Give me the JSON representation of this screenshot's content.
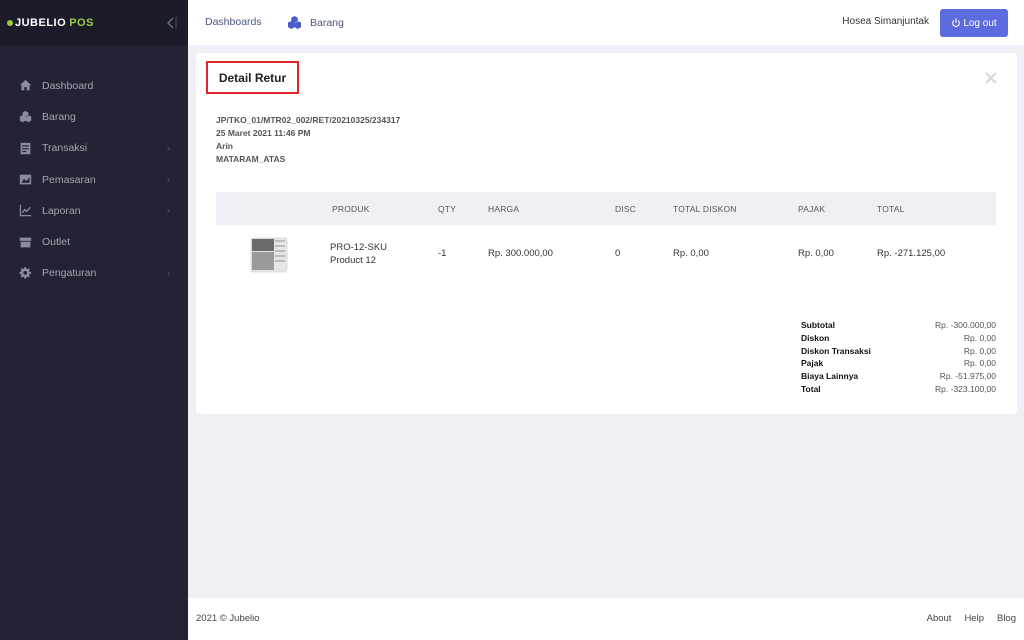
{
  "app": {
    "logo_main": "JUBELIO",
    "logo_sub": "POS",
    "accent": "#9ccd3c",
    "sidebar_bg": "#232333"
  },
  "sidebar": {
    "items": [
      {
        "label": "Dashboard",
        "icon": "home-icon",
        "has_children": false
      },
      {
        "label": "Barang",
        "icon": "cubes-icon",
        "has_children": false
      },
      {
        "label": "Transaksi",
        "icon": "receipt-icon",
        "has_children": true
      },
      {
        "label": "Pemasaran",
        "icon": "chart-area-icon",
        "has_children": true
      },
      {
        "label": "Laporan",
        "icon": "line-chart-icon",
        "has_children": true
      },
      {
        "label": "Outlet",
        "icon": "store-icon",
        "has_children": false
      },
      {
        "label": "Pengaturan",
        "icon": "gear-icon",
        "has_children": true
      }
    ]
  },
  "header": {
    "links": {
      "dashboards": "Dashboards",
      "barang": "Barang"
    },
    "user_name": "Hosea Simanjuntak",
    "logout_label": "Log out",
    "logout_color": "#5c6bde"
  },
  "detail": {
    "title": "Detail Retur",
    "ref_no": "JP/TKO_01/MTR02_002/RET/20210325/234317",
    "date": "25 Maret 2021 11:46 PM",
    "customer": "Arin",
    "location": "MATARAM_ATAS"
  },
  "table": {
    "headers": {
      "produk": "PRODUK",
      "qty": "QTY",
      "harga": "HARGA",
      "disc": "DISC",
      "total_diskon": "TOTAL DISKON",
      "pajak": "PAJAK",
      "total": "TOTAL"
    },
    "rows": [
      {
        "sku": "PRO-12-SKU",
        "name": "Product 12",
        "qty": "-1",
        "harga": "Rp. 300.000,00",
        "disc": "0",
        "total_diskon": "Rp. 0,00",
        "pajak": "Rp. 0,00",
        "total": "Rp. -271.125,00"
      }
    ]
  },
  "summary": [
    {
      "label": "Subtotal",
      "value": "Rp. -300.000,00"
    },
    {
      "label": "Diskon",
      "value": "Rp. 0,00"
    },
    {
      "label": "Diskon Transaksi",
      "value": "Rp. 0,00"
    },
    {
      "label": "Pajak",
      "value": "Rp. 0,00"
    },
    {
      "label": "Biaya Lainnya",
      "value": "Rp. -51.975,00"
    },
    {
      "label": "Total",
      "value": "Rp. -323.100,00"
    }
  ],
  "footer": {
    "copyright": "2021 © Jubelio",
    "links": {
      "about": "About",
      "help": "Help",
      "blog": "Blog"
    }
  }
}
